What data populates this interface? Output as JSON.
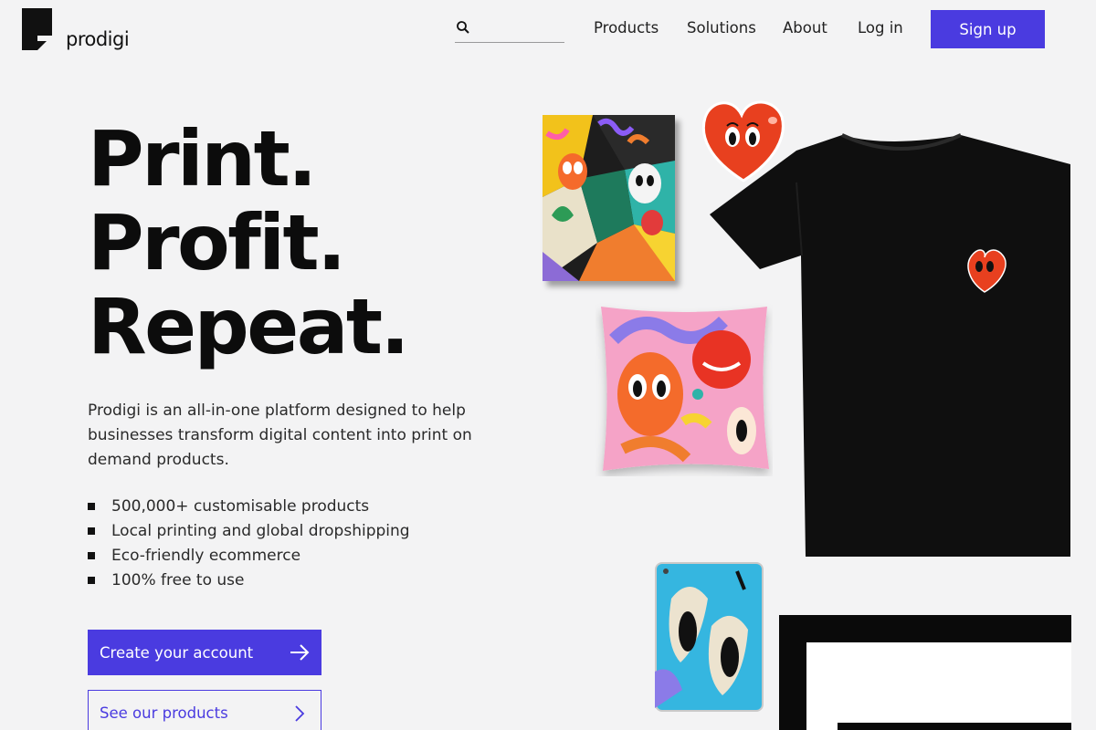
{
  "brand": {
    "name": "prodigi"
  },
  "search": {
    "placeholder": ""
  },
  "nav": {
    "products": "Products",
    "solutions": "Solutions",
    "about": "About",
    "login": "Log in",
    "signup": "Sign up"
  },
  "hero": {
    "line1": "Print.",
    "line2": "Profit.",
    "line3": "Repeat.",
    "description": "Prodigi is an all-in-one platform designed to help businesses transform digital content into print on demand products.",
    "bullets": [
      "500,000+ customisable products",
      "Local printing and global dropshipping",
      "Eco-friendly ecommerce",
      "100% free to use"
    ],
    "cta_primary": "Create your account",
    "cta_secondary": "See our products"
  },
  "icons": {
    "search": "search-icon",
    "arrow": "arrow-right-icon",
    "chevron": "chevron-right-icon"
  },
  "colors": {
    "accent": "#4a3be0",
    "background": "#f3f3f4",
    "text": "#0c0c0c"
  }
}
